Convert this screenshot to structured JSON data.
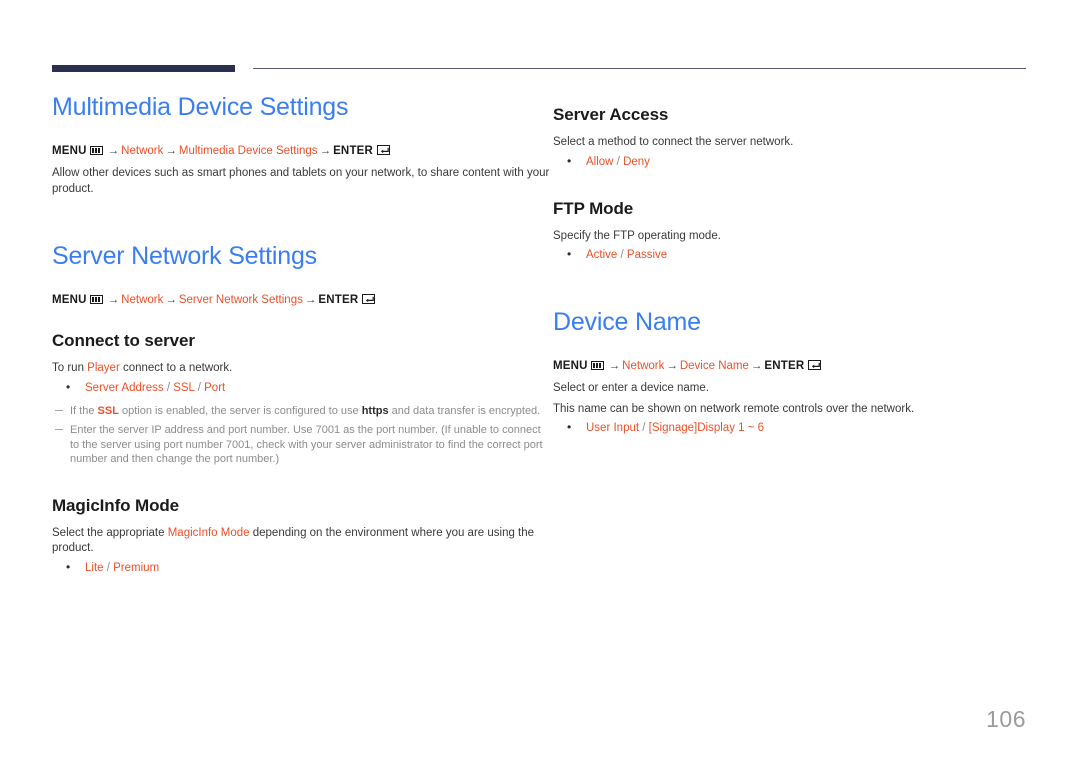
{
  "page": {
    "number": "106"
  },
  "icons": {
    "menu": "menu-icon",
    "enter": "enter-key-icon",
    "arrow": "→"
  },
  "left_column": {
    "section1": {
      "title": "Multimedia Device Settings",
      "path": {
        "menu_label": "MENU",
        "item1": "Network",
        "item2": "Multimedia Device Settings",
        "enter_label": "ENTER"
      },
      "body": "Allow other devices such as smart phones and tablets on your network, to share content with your product."
    },
    "section2": {
      "title": "Server Network Settings",
      "path": {
        "menu_label": "MENU",
        "item1": "Network",
        "item2": "Server Network Settings",
        "enter_label": "ENTER"
      },
      "sub1": {
        "heading": "Connect to server",
        "body_pre": "To run ",
        "body_hl": "Player",
        "body_post": " connect to a network.",
        "options": [
          {
            "a": "Server Address",
            "b": "SSL",
            "c": "Port"
          }
        ],
        "notes": [
          {
            "p1": "If the ",
            "hl": "SSL",
            "p2": " option is enabled, the server is configured to use ",
            "bold": "https",
            "p3": " and data transfer is encrypted."
          },
          {
            "text": "Enter the server IP address and port number. Use 7001 as the port number. (If unable to connect to the server using port number 7001, check with your server administrator to find the correct port number and then change the port number.)"
          }
        ]
      },
      "sub2": {
        "heading": "MagicInfo Mode",
        "body_pre": "Select the appropriate ",
        "body_hl": "MagicInfo Mode",
        "body_post": " depending on the environment where you are using the product.",
        "options": [
          {
            "a": "Lite",
            "b": "Premium"
          }
        ]
      }
    }
  },
  "right_column": {
    "section1": {
      "heading": "Server Access",
      "body": "Select a method to connect the server network.",
      "options": [
        {
          "a": "Allow",
          "b": "Deny"
        }
      ]
    },
    "section2": {
      "heading": "FTP Mode",
      "body": "Specify the FTP operating mode.",
      "options": [
        {
          "a": "Active",
          "b": "Passive"
        }
      ]
    },
    "section3": {
      "title": "Device Name",
      "path": {
        "menu_label": "MENU",
        "item1": "Network",
        "item2": "Device Name",
        "enter_label": "ENTER"
      },
      "body1": "Select or enter a device name.",
      "body2": "This name can be shown on network remote controls over the network.",
      "options": [
        {
          "a": "User Input",
          "b": "[Signage]Display  1 ~ 6"
        }
      ]
    }
  },
  "colors": {
    "heading_blue": "#3a7ef0",
    "accent_orange": "#e8512b",
    "rule_navy": "#2b3050",
    "body_gray": "#3a3a3a",
    "note_gray": "#8d8d8d",
    "pageno_gray": "#9b9b9b"
  }
}
